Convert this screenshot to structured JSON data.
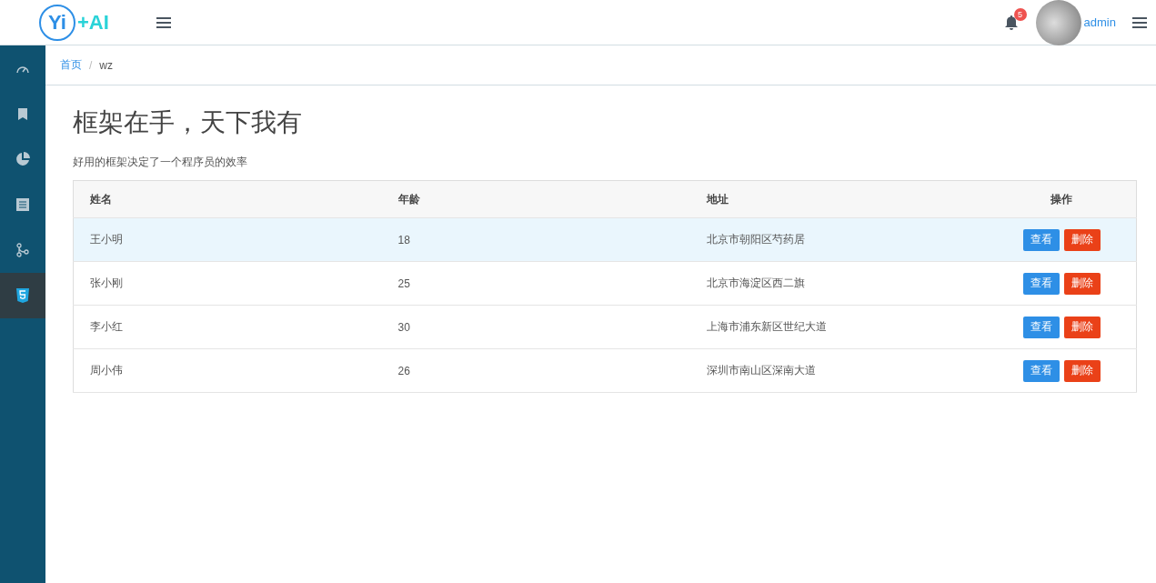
{
  "header": {
    "logo": [
      "Yi",
      "+AI"
    ],
    "notifications": "5",
    "user": "admin"
  },
  "sidebar": {
    "items": [
      {
        "kind": "gauge",
        "selected": false
      },
      {
        "kind": "bookmark",
        "selected": false
      },
      {
        "kind": "pie",
        "selected": false
      },
      {
        "kind": "document",
        "selected": false
      },
      {
        "kind": "branch",
        "selected": false
      },
      {
        "kind": "html5",
        "selected": true
      }
    ]
  },
  "breadcrumb": [
    {
      "label": "首页",
      "link": true
    },
    {
      "label": "wz",
      "link": false
    }
  ],
  "breadcrumb_separator": "/",
  "title": "框架在手，天下我有",
  "subtitle": "好用的框架决定了一个程序员的效率",
  "table": {
    "columns": [
      "姓名",
      "年龄",
      "地址",
      "操作"
    ],
    "rows": [
      {
        "cells": [
          "王小明",
          "18",
          "北京市朝阳区芍药居"
        ],
        "highlighted": true,
        "actions": [
          "查看",
          "删除"
        ]
      },
      {
        "cells": [
          "张小刚",
          "25",
          "北京市海淀区西二旗"
        ],
        "highlighted": false,
        "actions": [
          "查看",
          "删除"
        ]
      },
      {
        "cells": [
          "李小红",
          "30",
          "上海市浦东新区世纪大道"
        ],
        "highlighted": false,
        "actions": [
          "查看",
          "删除"
        ]
      },
      {
        "cells": [
          "周小伟",
          "26",
          "深圳市南山区深南大道"
        ],
        "highlighted": false,
        "actions": [
          "查看",
          "删除"
        ]
      }
    ]
  }
}
